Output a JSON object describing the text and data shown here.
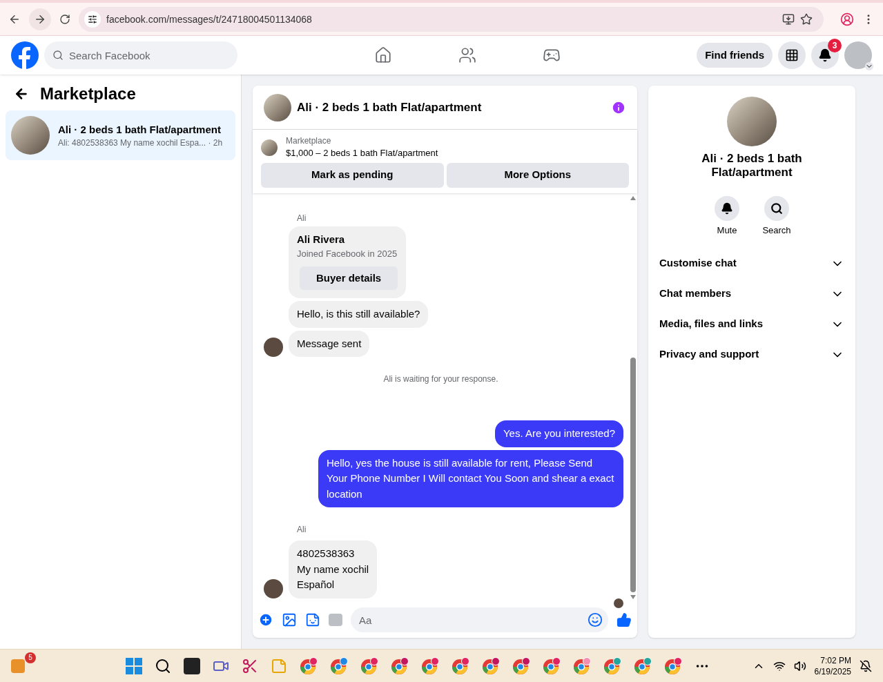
{
  "browser": {
    "url": "facebook.com/messages/t/24718004501134068"
  },
  "header": {
    "search_placeholder": "Search Facebook",
    "find_friends": "Find friends",
    "notification_count": "3"
  },
  "sidebar": {
    "title": "Marketplace",
    "items": [
      {
        "title": "Ali · 2 beds 1 bath Flat/apartment",
        "preview": "Ali: 4802538363 My name xochil Espa... · 2h",
        "selected": true
      }
    ]
  },
  "chat": {
    "title": "Ali · 2 beds 1 bath Flat/apartment",
    "listing_label": "Marketplace",
    "listing_text": "$1,000 – 2 beds 1 bath Flat/apartment",
    "buttons": [
      "Mark as pending",
      "More Options"
    ],
    "messages": [
      {
        "kind": "sender",
        "text": "Ali"
      },
      {
        "kind": "profile",
        "name": "Ali Rivera",
        "subtitle": "Joined Facebook in 2025",
        "button": "Buyer details"
      },
      {
        "kind": "incoming",
        "text": "Hello, is this still available?",
        "avatar": false
      },
      {
        "kind": "incoming",
        "text": "Message sent",
        "avatar": true
      },
      {
        "kind": "status",
        "text": "Ali is waiting for your response."
      },
      {
        "kind": "outgoing",
        "text": "Yes. Are you interested?"
      },
      {
        "kind": "outgoing",
        "text": "Hello, yes the house is still available for rent, Please Send Your Phone Number I Will contact You Soon and shear a exact location"
      },
      {
        "kind": "sender",
        "text": "Ali"
      },
      {
        "kind": "incoming",
        "text": "4802538363\nMy name xochil\nEspañol",
        "avatar": true
      }
    ],
    "composer_placeholder": "Aa"
  },
  "details": {
    "title": "Ali · 2 beds 1 bath Flat/apartment",
    "actions": [
      "Mute",
      "Search"
    ],
    "sections": [
      "Customise chat",
      "Chat members",
      "Media, files and links",
      "Privacy and support"
    ]
  },
  "taskbar": {
    "widget_badge": "5",
    "time": "7:02 PM",
    "date": "6/19/2025"
  }
}
